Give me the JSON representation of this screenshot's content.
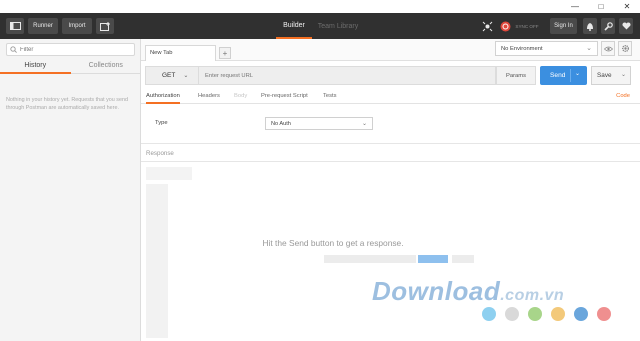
{
  "header": {
    "runner_label": "Runner",
    "import_label": "Import",
    "tabs": [
      {
        "label": "Builder",
        "active": true
      },
      {
        "label": "Team Library",
        "active": false
      }
    ],
    "sync_label": "SYNC OFF",
    "signin_label": "Sign In"
  },
  "sidebar": {
    "filter_placeholder": "Filter",
    "tabs": [
      "History",
      "Collections"
    ],
    "empty_message": "Nothing in your history yet. Requests that you send through Postman are automatically saved here."
  },
  "main": {
    "request_tab_label": "New Tab",
    "add_tab_label": "+",
    "environment": "No Environment",
    "method": "GET",
    "url_placeholder": "Enter request URL",
    "params_label": "Params",
    "send_label": "Send",
    "save_label": "Save",
    "subtabs": [
      {
        "label": "Authorization",
        "state": "active"
      },
      {
        "label": "Headers",
        "state": "normal"
      },
      {
        "label": "Body",
        "state": "disabled"
      },
      {
        "label": "Pre-request Script",
        "state": "normal"
      },
      {
        "label": "Tests",
        "state": "normal"
      }
    ],
    "code_label": "Code",
    "type_label": "Type",
    "auth_type": "No Auth",
    "response_label": "Response",
    "hint": "Hit the Send button to get a response."
  },
  "watermark": {
    "text": "Download",
    "suffix": ".com.vn"
  },
  "colors": {
    "accent": "#f47023",
    "send_blue": "#3b8fe0",
    "dots": [
      "#8ed0f0",
      "#d9d9d9",
      "#a8d58a",
      "#f3c97a",
      "#6aa6dc",
      "#ef8f8f"
    ]
  }
}
